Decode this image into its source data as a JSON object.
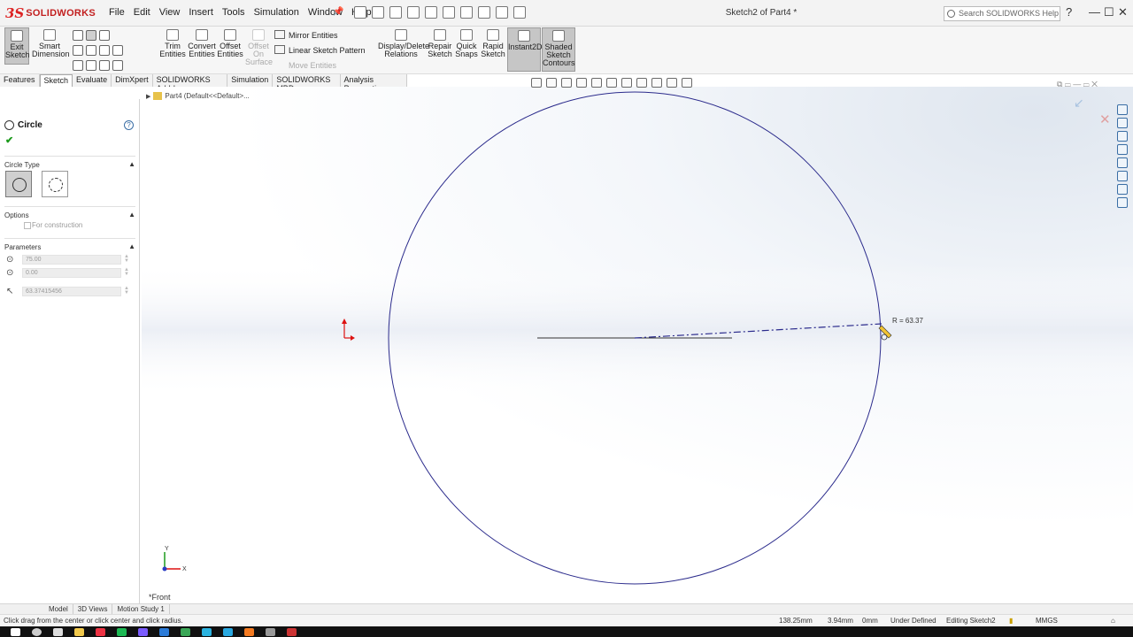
{
  "app": {
    "brand_mark": "3S",
    "brand_name": "SOLIDWORKS",
    "doc_title": "Sketch2 of Part4 *"
  },
  "menu": [
    "File",
    "Edit",
    "View",
    "Insert",
    "Tools",
    "Simulation",
    "Window",
    "Help"
  ],
  "search": {
    "placeholder": "Search SOLIDWORKS Help"
  },
  "window_controls": {
    "help": "?",
    "minimize": "—",
    "maximize": "☐",
    "close": "✕"
  },
  "commands": {
    "exit_sketch": "Exit Sketch",
    "smart_dimension": "Smart Dimension",
    "trim_entities": "Trim Entities",
    "convert_entities": "Convert Entities",
    "offset_entities": "Offset Entities",
    "offset_on_surface": "Offset On Surface",
    "mirror_entities": "Mirror Entities",
    "linear_sketch_pattern": "Linear Sketch Pattern",
    "move_entities": "Move Entities",
    "display_delete_relations": "Display/Delete Relations",
    "repair_sketch": "Repair Sketch",
    "quick_snaps": "Quick Snaps",
    "rapid_sketch": "Rapid Sketch",
    "instant2d": "Instant2D",
    "shaded_sketch_contours": "Shaded Sketch Contours"
  },
  "tabs": [
    "Features",
    "Sketch",
    "Evaluate",
    "DimXpert",
    "SOLIDWORKS Add-Ins",
    "Simulation",
    "SOLIDWORKS MBD",
    "Analysis Preparation"
  ],
  "active_tab": "Sketch",
  "property_manager": {
    "title": "Circle",
    "help": "?",
    "ok": "✔",
    "circle_type": {
      "label": "Circle Type",
      "selected": "center-circle"
    },
    "options": {
      "label": "Options",
      "for_construction": "For construction",
      "for_construction_checked": false
    },
    "parameters": {
      "label": "Parameters",
      "x": "75.00",
      "y": "0.00",
      "radius": "63.37415456"
    }
  },
  "tree": {
    "label": "Part4  (Default<<Default>..."
  },
  "graphics": {
    "radius_tip": "R = 63.37",
    "view_label": "*Front",
    "triad": {
      "x": "X",
      "y": "Y"
    }
  },
  "bottom_tabs": [
    "Model",
    "3D Views",
    "Motion Study 1"
  ],
  "active_bottom_tab": "Model",
  "status": {
    "hint": "Click drag from the center or click center and click radius.",
    "x": "138.25mm",
    "y": "3.94mm",
    "z": "0mm",
    "state": "Under Defined",
    "editing": "Editing Sketch2",
    "units": "MMGS"
  },
  "colors": {
    "sketch_line": "#2b2b8c",
    "accent": "#c21f1f",
    "ok_green": "#1c9a1c"
  }
}
